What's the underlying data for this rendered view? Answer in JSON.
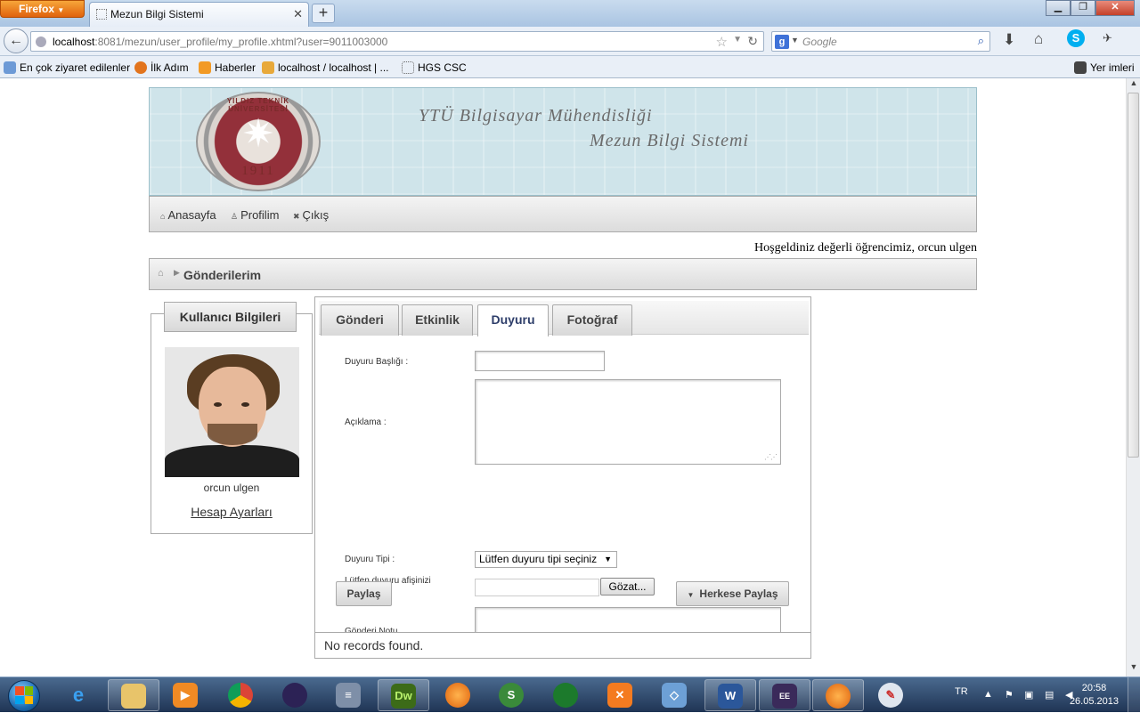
{
  "browser": {
    "app_button": "Firefox",
    "tab_title": "Mezun Bilgi Sistemi",
    "url_host": "localhost",
    "url_rest": ":8081/mezun/user_profile/my_profile.xhtml?user=9011003000",
    "search_engine": "Google",
    "bookmarks": [
      "En çok ziyaret edilenler",
      "İlk Adım",
      "Haberler",
      "localhost / localhost | ...",
      "HGS CSC"
    ],
    "bookmarks_right": "Yer imleri"
  },
  "header": {
    "line1": "YTÜ Bilgisayar Mühendisliği",
    "line2": "Mezun Bilgi Sistemi",
    "seal_arc": "YILDIZ TEKNİK ÜNİVERSİTESİ",
    "seal_year": "1911"
  },
  "menu": {
    "home": "Anasayfa",
    "profile": "Profilim",
    "logout": "Çıkış"
  },
  "welcome": "Hoşgeldiniz değerli öğrencimiz, orcun ulgen",
  "breadcrumb": "Gönderilerim",
  "user_panel": {
    "title": "Kullanıcı Bilgileri",
    "name": "orcun ulgen",
    "account_link": "Hesap Ayarları"
  },
  "tabs": [
    "Gönderi",
    "Etkinlik",
    "Duyuru",
    "Fotoğraf"
  ],
  "active_tab": "Duyuru",
  "form": {
    "title_label": "Duyuru Başlığı :",
    "desc_label": "Açıklama :",
    "type_label": "Duyuru Tipi :",
    "type_selected": "Lütfen duyuru tipi seçiniz",
    "poster_label": "Lütfen duyuru afişinizi belirleyiniz.",
    "browse_button": "Gözat...",
    "note_label": "Gönderi Notu",
    "share_button": "Paylaş",
    "share_all_button": "Herkese Paylaş"
  },
  "records": "No records found.",
  "taskbar": {
    "lang": "TR",
    "time": "20:58",
    "date": "26.05.2013"
  }
}
